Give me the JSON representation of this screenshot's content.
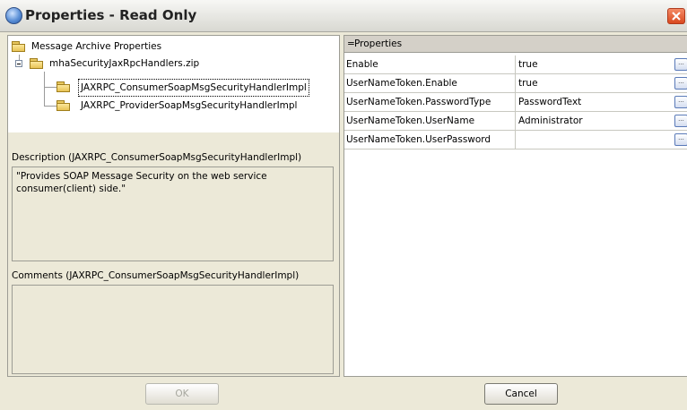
{
  "window": {
    "title": "Properties - Read Only"
  },
  "tree": {
    "root": "Message Archive Properties",
    "archive": "mhaSecurityJaxRpcHandlers.zip",
    "items": [
      {
        "label": "JAXRPC_ConsumerSoapMsgSecurityHandlerImpl"
      },
      {
        "label": "JAXRPC_ProviderSoapMsgSecurityHandlerImpl"
      }
    ]
  },
  "description": {
    "label": "Description (JAXRPC_ConsumerSoapMsgSecurityHandlerImpl)",
    "text": "\"Provides SOAP Message Security on the web service consumer(client) side.\""
  },
  "comments": {
    "label": "Comments (JAXRPC_ConsumerSoapMsgSecurityHandlerImpl)",
    "text": ""
  },
  "properties": {
    "toggle": "=",
    "header": "Properties",
    "rows": [
      {
        "name": "Enable",
        "value": "true"
      },
      {
        "name": "UserNameToken.Enable",
        "value": "true"
      },
      {
        "name": "UserNameToken.PasswordType",
        "value": "PasswordText"
      },
      {
        "name": "UserNameToken.UserName",
        "value": "Administrator"
      },
      {
        "name": "UserNameToken.UserPassword",
        "value": ""
      }
    ],
    "ellipsis": "..."
  },
  "buttons": {
    "ok": "OK",
    "cancel": "Cancel"
  }
}
